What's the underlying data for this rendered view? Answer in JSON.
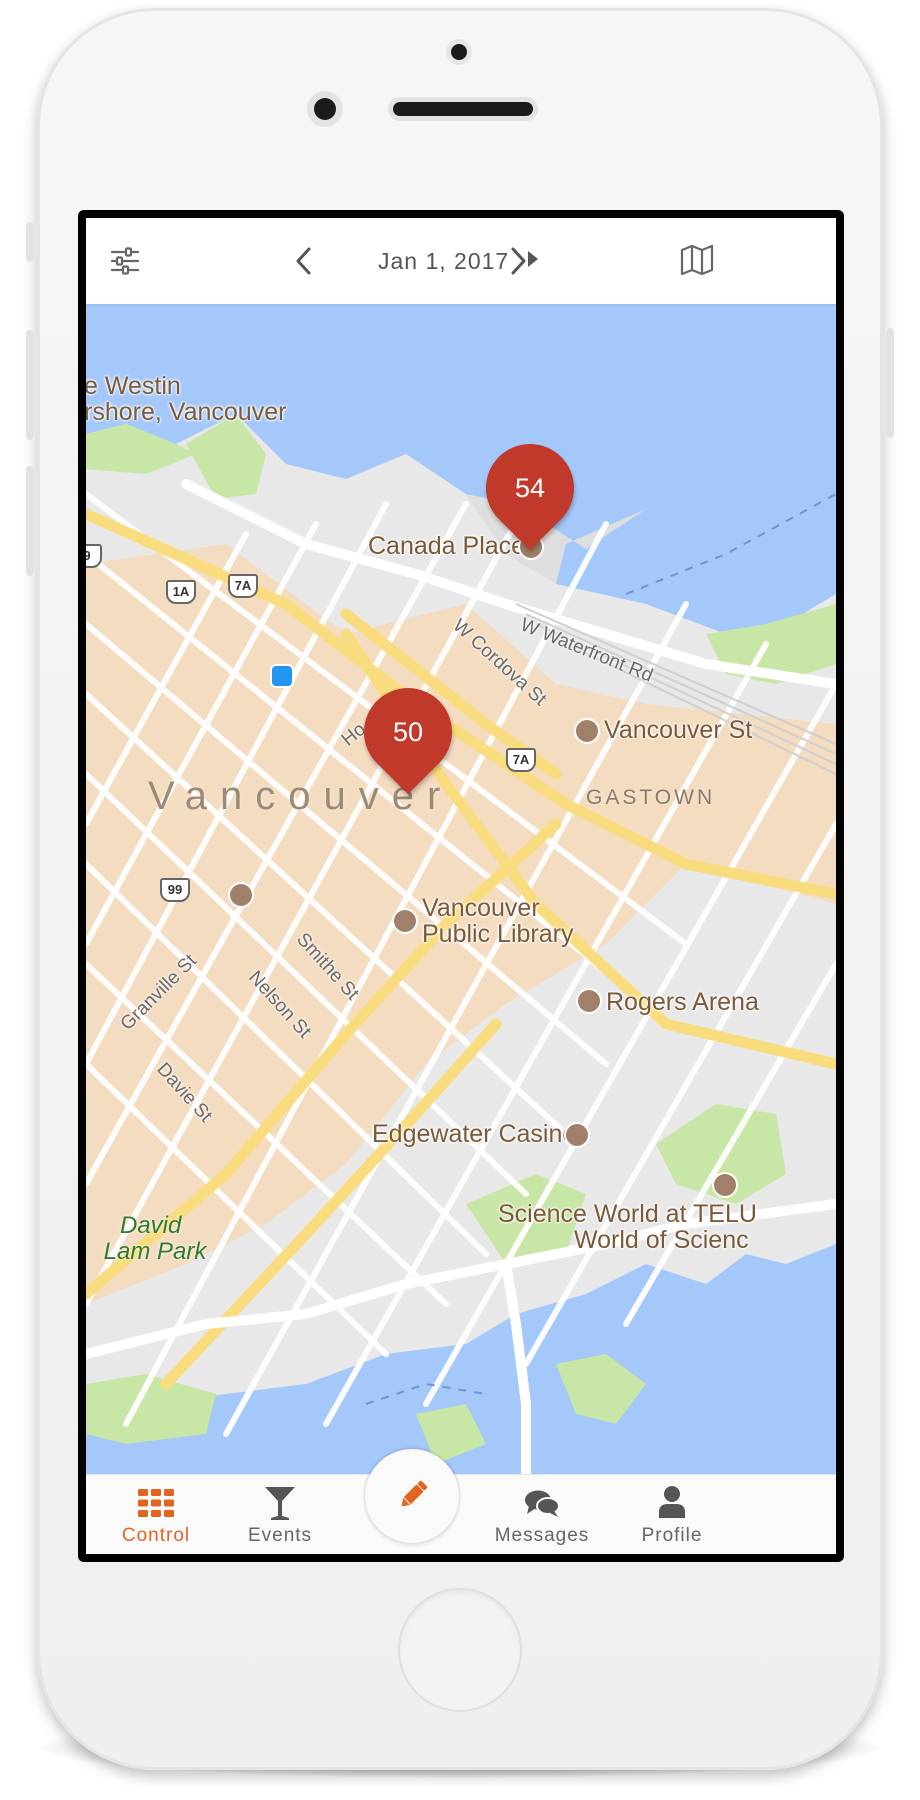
{
  "header": {
    "date": "Jan 1, 2017"
  },
  "map": {
    "places": {
      "westin_line1": "e Westin",
      "westin_line2": "rshore, Vancouver",
      "canada_place": "Canada Place",
      "vancouver_station": "Vancouver St",
      "library_line1": "Vancouver",
      "library_line2": "Public Library",
      "rogers_arena": "Rogers Arena",
      "edgewater_casino": "Edgewater Casino",
      "science_world_line1": "Science World at TELU",
      "science_world_line2": "World of Scienc",
      "david_lam_park_line1": "David",
      "david_lam_park_line2": "Lam Park"
    },
    "districts": {
      "vancouver": "Vancouver",
      "gastown": "GASTOWN"
    },
    "streets": {
      "w_waterfront": "W Waterfront Rd",
      "w_cordova": "W Cordova St",
      "howe": "Ho",
      "smithe": "Smithe St",
      "nelson": "Nelson St",
      "granville": "Granville St",
      "davie": "Davie St"
    },
    "highway_shields": {
      "a": "1A",
      "b": "7A",
      "c": "7A",
      "d": "99",
      "e": "9"
    },
    "markers": [
      {
        "count": "54"
      },
      {
        "count": "50"
      }
    ],
    "colors": {
      "water": "#a4c8fa",
      "land": "#e8e8e8",
      "park": "#c8e6a5",
      "downtown": "#f4dcc0",
      "major_road": "#f9dc7e",
      "marker": "#c0392b"
    }
  },
  "nav": {
    "items": [
      {
        "label": "Control",
        "icon": "grid-icon",
        "active": true
      },
      {
        "label": "Events",
        "icon": "cocktail-icon",
        "active": false
      },
      {
        "label": "Messages",
        "icon": "chat-bubbles-icon",
        "active": false
      },
      {
        "label": "Profile",
        "icon": "person-icon",
        "active": false
      }
    ],
    "fab_icon": "pencil-icon",
    "accent": "#e3641f"
  }
}
